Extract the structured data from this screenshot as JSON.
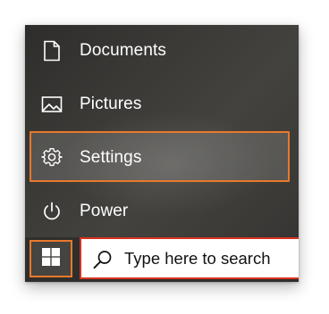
{
  "start_menu": {
    "items": [
      {
        "label": "Documents",
        "icon": "document-icon"
      },
      {
        "label": "Pictures",
        "icon": "pictures-icon"
      },
      {
        "label": "Settings",
        "icon": "gear-icon"
      },
      {
        "label": "Power",
        "icon": "power-icon"
      }
    ]
  },
  "taskbar": {
    "start_button_icon": "windows-logo-icon",
    "search": {
      "icon": "search-icon",
      "placeholder": "Type here to search"
    }
  },
  "colors": {
    "highlight_outline": "#e8792a",
    "search_border": "#d9321f",
    "menu_background": "#3a3936",
    "text": "#ffffff"
  }
}
